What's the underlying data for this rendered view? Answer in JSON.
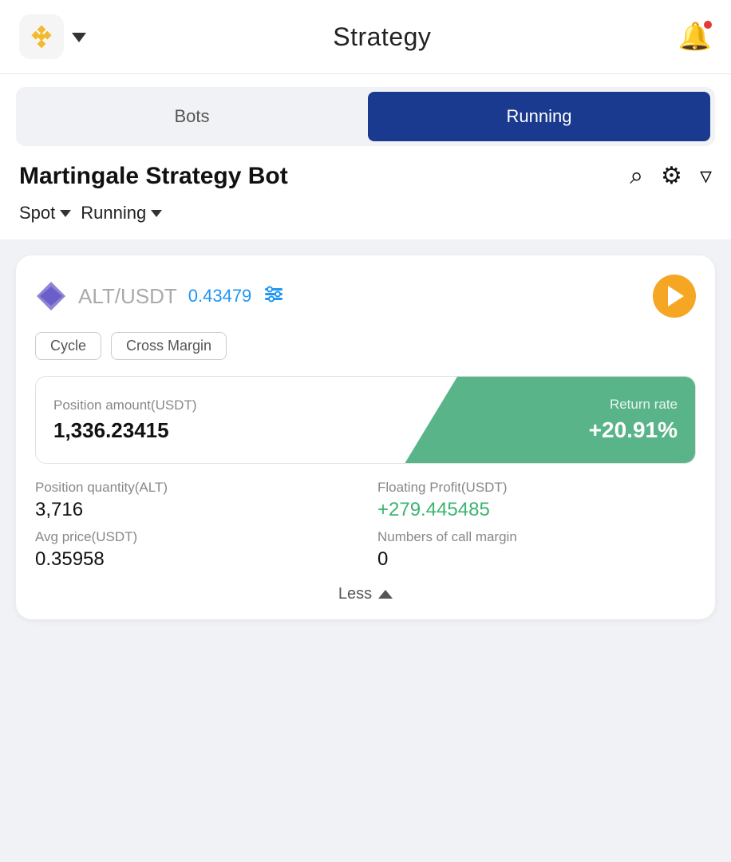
{
  "header": {
    "title": "Strategy",
    "logo_alt": "Binance Logo",
    "chevron_alt": "dropdown arrow"
  },
  "tabs": {
    "bots_label": "Bots",
    "running_label": "Running",
    "active_tab": "running"
  },
  "filter_bar": {
    "title": "Martingale Strategy Bot",
    "search_icon": "search-icon",
    "settings_icon": "settings-icon",
    "filter_icon": "filter-icon"
  },
  "dropdowns": {
    "spot_label": "Spot",
    "running_label": "Running"
  },
  "card": {
    "token_icon_alt": "ALT token icon",
    "pair": "ALT",
    "pair_quote": "/USDT",
    "price": "0.43479",
    "tag_cycle": "Cycle",
    "tag_margin": "Cross Margin",
    "position_amount_label": "Position amount(USDT)",
    "position_amount_value": "1,336.23415",
    "return_rate_label": "Return rate",
    "return_rate_value": "+20.91%",
    "position_qty_label": "Position quantity(ALT)",
    "position_qty_value": "3,716",
    "floating_profit_label": "Floating Profit(USDT)",
    "floating_profit_value": "+279.445485",
    "avg_price_label": "Avg price(USDT)",
    "avg_price_value": "0.35958",
    "call_margin_label": "Numbers of call margin",
    "call_margin_value": "0",
    "less_label": "Less"
  }
}
